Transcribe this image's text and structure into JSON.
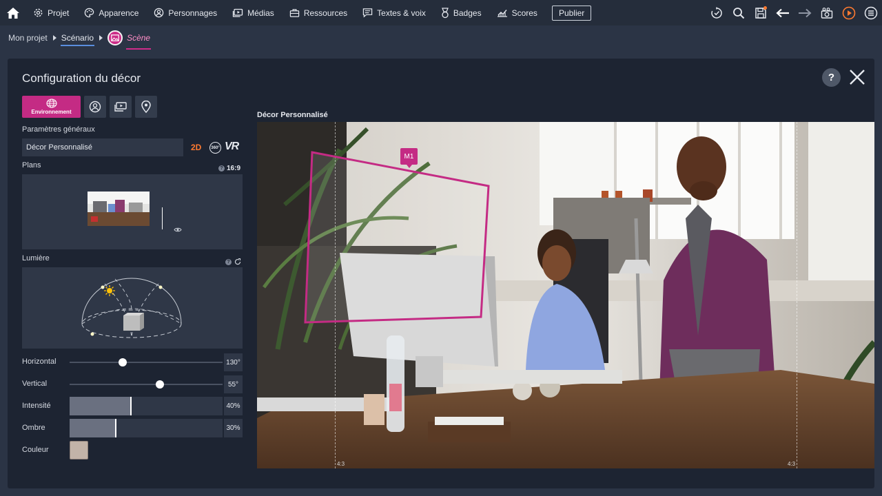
{
  "topbar": {
    "menu": [
      {
        "label": "Projet",
        "icon": "gear-icon"
      },
      {
        "label": "Apparence",
        "icon": "palette-icon"
      },
      {
        "label": "Personnages",
        "icon": "person-icon"
      },
      {
        "label": "Médias",
        "icon": "media-icon"
      },
      {
        "label": "Ressources",
        "icon": "briefcase-icon"
      },
      {
        "label": "Textes & voix",
        "icon": "speech-icon"
      },
      {
        "label": "Badges",
        "icon": "badge-icon"
      },
      {
        "label": "Scores",
        "icon": "chart-icon"
      }
    ],
    "publish_label": "Publier",
    "right_icons": [
      "check-circle-icon",
      "search-icon",
      "save-icon",
      "arrow-left-icon",
      "arrow-right-icon",
      "camera-icon",
      "play-icon",
      "menu-icon"
    ]
  },
  "breadcrumb": {
    "project": "Mon projet",
    "scenario": "Scénario",
    "scene": "Scène"
  },
  "modal": {
    "title": "Configuration du décor",
    "help_label": "?",
    "tabs": [
      {
        "label": "Environnement",
        "icon": "globe-icon",
        "active": true
      },
      {
        "label": "",
        "icon": "character-icon",
        "active": false
      },
      {
        "label": "",
        "icon": "projector-icon",
        "active": false
      },
      {
        "label": "",
        "icon": "location-pin-icon",
        "active": false
      }
    ],
    "general_label": "Paramètres généraux",
    "decor_value": "Décor Personnalisé",
    "mode_2d": "2D",
    "mode_360": "360°",
    "mode_vr": "VR",
    "plans_label": "Plans",
    "ratio_label": "16:9",
    "ratio_help": "?",
    "light_label": "Lumière",
    "light_help": "?",
    "sliders": {
      "horizontal": {
        "label": "Horizontal",
        "value": "130°",
        "fraction": 0.345
      },
      "vertical": {
        "label": "Vertical",
        "value": "55°",
        "fraction": 0.59
      },
      "intensity": {
        "label": "Intensité",
        "value": "40%",
        "fraction": 0.4
      },
      "shadow": {
        "label": "Ombre",
        "value": "30%",
        "fraction": 0.3
      }
    },
    "color_label": "Couleur",
    "color_value": "#c2b3a8"
  },
  "preview": {
    "title": "Décor Personnalisé",
    "marker_label": "M1",
    "ratio_left": "4:3",
    "ratio_right": "4:3"
  },
  "colors": {
    "accent": "#c42b84",
    "orange": "#ff7a30",
    "topbar": "#252d3b",
    "modal": "#1d2432"
  }
}
